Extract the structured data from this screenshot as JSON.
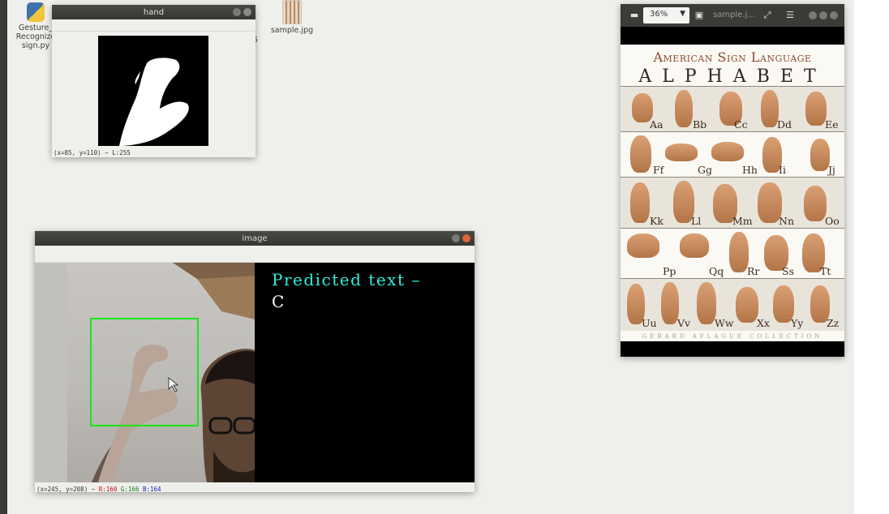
{
  "desktop": {
    "icons": [
      {
        "label_lines": [
          "Gesture_",
          "Recognize",
          "sign.py"
        ],
        "icon": "python-file-icon"
      },
      {
        "label_lines": [
          "sample.jpg"
        ],
        "icon": "image-file-icon"
      },
      {
        "label_lines": [
          "5"
        ],
        "icon": "file-icon"
      }
    ]
  },
  "hand_window": {
    "title": "hand",
    "status": "(x=85, y=110) ~ L:255"
  },
  "image_window": {
    "title": "image",
    "predicted_label": "Predicted text –",
    "predicted_value": "C",
    "status_pos": "(x=245, y=208) ~",
    "status_r": "R:160",
    "status_g": "G:166",
    "status_b": "B:164",
    "colors": {
      "bbox": "#19e619",
      "predicted_text": "#2ff0e0",
      "r": "#c01010",
      "g": "#108010",
      "b": "#1020c0"
    }
  },
  "viewer": {
    "zoom": "36%",
    "title": "sample.j...",
    "poster": {
      "title_line1": "American Sign Language",
      "title_line2": "ALPHABET",
      "rows": [
        [
          "Aa",
          "Bb",
          "Cc",
          "Dd",
          "Ee"
        ],
        [
          "Ff",
          "Gg",
          "Hh",
          "Ii",
          "Jj"
        ],
        [
          "Kk",
          "Ll",
          "Mm",
          "Nn",
          "Oo"
        ],
        [
          "Pp",
          "Qq",
          "Rr",
          "Ss",
          "Tt"
        ],
        [
          "Uu",
          "Vv",
          "Ww",
          "Xx",
          "Yy",
          "Zz"
        ]
      ],
      "footer": "GERARD AFLAGUE COLLECTION"
    }
  }
}
